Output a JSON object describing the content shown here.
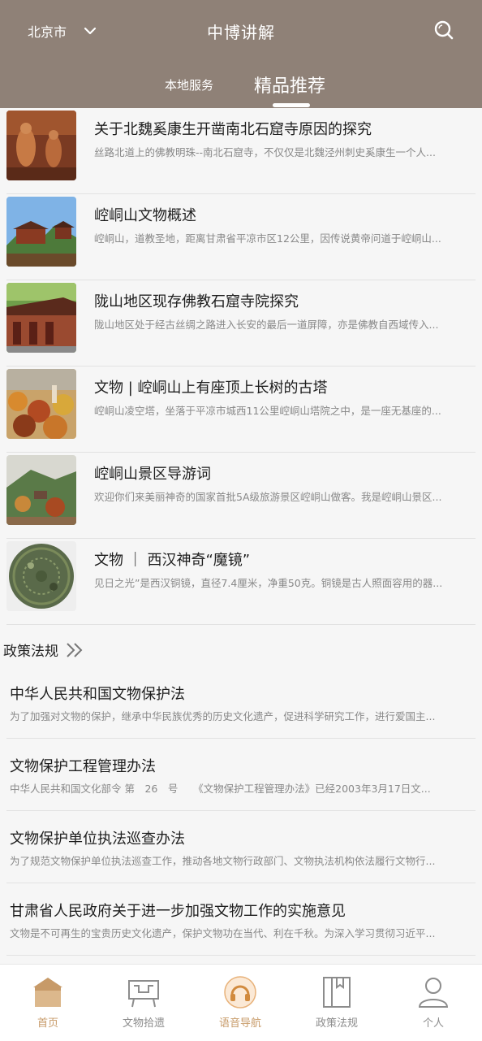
{
  "header": {
    "city": "北京市",
    "title": "中博讲解",
    "tabs": [
      {
        "label": "本地服务",
        "active": false
      },
      {
        "label": "精品推荐",
        "active": true
      }
    ],
    "background_color": "#8f8177"
  },
  "articles": [
    {
      "title": "关于北魏奚康生开凿南北石窟寺原因的探究",
      "summary": "丝路北道上的佛教明珠--南北石窟寺，不仅仅是北魏泾州刺史奚康生一个人..."
    },
    {
      "title": "崆峒山文物概述",
      "summary": "崆峒山，道教圣地，距离甘肃省平凉市区12公里，因传说黄帝问道于崆峒山..."
    },
    {
      "title": "陇山地区现存佛教石窟寺院探究",
      "summary": "陇山地区处于经古丝绸之路进入长安的最后一道屏障，亦是佛教自西域传入..."
    },
    {
      "title": "文物 | 崆峒山上有座顶上长树的古塔",
      "summary": "崆峒山凌空塔，坐落于平凉市城西11公里崆峒山塔院之中，是一座无基座的..."
    },
    {
      "title": "崆峒山景区导游词",
      "summary": "欢迎你们来美丽神奇的国家首批5A级旅游景区崆峒山做客。我是崆峒山景区..."
    },
    {
      "title": "文物 ｜ 西汉神奇“魔镜”",
      "summary": "见日之光”是西汉铜镜，直径7.4厘米，净重50克。铜镜是古人照面容用的器..."
    }
  ],
  "policy_section": {
    "heading": "政策法规",
    "items": [
      {
        "title": "中华人民共和国文物保护法",
        "summary": "为了加强对文物的保护，继承中华民族优秀的历史文化遗产，促进科学研究工作，进行爱国主..."
      },
      {
        "title": "文物保护工程管理办法",
        "summary": "中华人民共和国文化部令 第　26　号　　《文物保护工程管理办法》已经2003年3月17日文..."
      },
      {
        "title": "文物保护单位执法巡查办法",
        "summary": "为了规范文物保护单位执法巡查工作，推动各地文物行政部门、文物执法机构依法履行文物行..."
      },
      {
        "title": "甘肃省人民政府关于进一步加强文物工作的实施意见",
        "summary": "文物是不可再生的宝贵历史文化遗产，保护文物功在当代、利在千秋。为深入学习贯彻习近平..."
      }
    ]
  },
  "bottom_nav": {
    "items": [
      {
        "label": "首页",
        "icon": "home-icon",
        "active": true
      },
      {
        "label": "文物拾遗",
        "icon": "artifact-icon",
        "active": false
      },
      {
        "label": "语音导航",
        "icon": "headphones-icon",
        "active": false
      },
      {
        "label": "政策法规",
        "icon": "book-icon",
        "active": false
      },
      {
        "label": "个人",
        "icon": "user-icon",
        "active": false
      }
    ],
    "accent_color": "#c79a68"
  }
}
